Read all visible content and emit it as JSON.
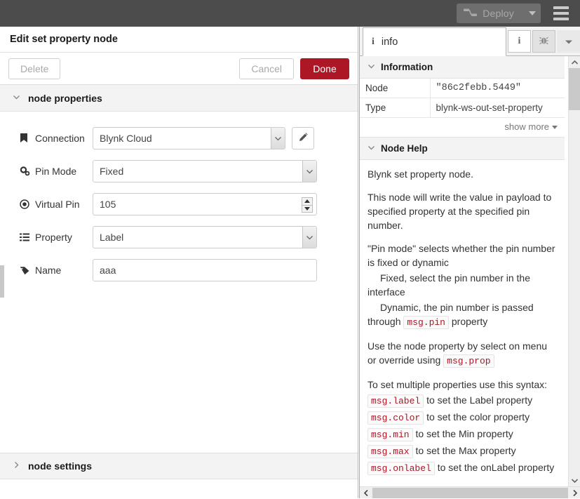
{
  "topbar": {
    "deploy_label": "Deploy",
    "deploy_icon": "deploy-node-icon",
    "deploy_caret_icon": "caret-down-icon",
    "menu_icon": "hamburger-menu-icon",
    "bg_color": "#4c4c4c",
    "deploy_disabled": true
  },
  "editor": {
    "title": "Edit set property node",
    "buttons": {
      "delete": "Delete",
      "cancel": "Cancel",
      "done": "Done",
      "done_color": "#ad1625"
    },
    "sections": {
      "properties": {
        "label": "node properties",
        "chevron": "chevron-down-icon",
        "expanded": true
      },
      "settings": {
        "label": "node settings",
        "chevron": "chevron-right-icon",
        "expanded": false
      }
    },
    "fields": [
      {
        "key": "connection",
        "icon": "bookmark-icon",
        "label": "Connection",
        "type": "select",
        "value": "Blynk Cloud",
        "has_edit_button": true,
        "edit_icon": "pencil-icon"
      },
      {
        "key": "pinmode",
        "icon": "cogs-icon",
        "label": "Pin Mode",
        "type": "select",
        "value": "Fixed"
      },
      {
        "key": "vpin",
        "icon": "dot-circle-icon",
        "label": "Virtual Pin",
        "type": "number",
        "value": "105"
      },
      {
        "key": "property",
        "icon": "list-icon",
        "label": "Property",
        "type": "select",
        "value": "Label"
      },
      {
        "key": "name",
        "icon": "tag-icon",
        "label": "Name",
        "type": "text",
        "value": "aaa"
      }
    ]
  },
  "sidebar": {
    "tab": {
      "label": "info",
      "icon": "info-icon"
    },
    "tab_buttons": [
      {
        "name": "info-tab-button",
        "icon": "info-icon",
        "active": false
      },
      {
        "name": "debug-tab-button",
        "icon": "bug-icon",
        "active": true
      },
      {
        "name": "sidebar-menu-button",
        "icon": "caret-down-icon",
        "active": false
      }
    ],
    "information": {
      "section_label": "Information",
      "chevron": "chevron-down-icon",
      "rows": [
        {
          "key": "Node",
          "value": "\"86c2febb.5449\"",
          "style": "code"
        },
        {
          "key": "Type",
          "value": "blynk-ws-out-set-property",
          "style": "plain"
        }
      ],
      "show_more": "show more"
    },
    "node_help": {
      "section_label": "Node Help",
      "chevron": "chevron-down-icon",
      "paragraphs": [
        {
          "kind": "p",
          "text": "Blynk set property node."
        },
        {
          "kind": "p",
          "text": "This node will write the value in payload to specified property at the specified pin number."
        },
        {
          "kind": "p-tight",
          "text": "\"Pin mode\" selects whether the pin number is fixed or dynamic"
        },
        {
          "kind": "p-tight-indent",
          "text": "Fixed, select the pin number in the interface"
        },
        {
          "kind": "mixed-indent",
          "pre": "Dynamic, the pin number is passed through ",
          "code": "msg.pin",
          "post": " property"
        },
        {
          "kind": "mixed",
          "pre": "Use the node property by select on menu or override using ",
          "code": "msg.prop",
          "post": ""
        },
        {
          "kind": "p-tight",
          "text": "To set multiple properties use this syntax:"
        },
        {
          "kind": "mixed-tight",
          "pre": "",
          "code": "msg.label",
          "post": " to set the Label property"
        },
        {
          "kind": "mixed-tight",
          "pre": "",
          "code": "msg.color",
          "post": " to set the color property"
        },
        {
          "kind": "mixed-tight",
          "pre": "",
          "code": "msg.min",
          "post": " to set the Min property"
        },
        {
          "kind": "mixed-tight",
          "pre": "",
          "code": "msg.max",
          "post": " to set the Max property"
        },
        {
          "kind": "mixed-tight",
          "pre": "",
          "code": "msg.onlabel",
          "post": " to set the onLabel property"
        }
      ]
    },
    "scrollbars": {
      "v_up_icon": "scroll-up-icon",
      "v_down_icon": "scroll-down-icon",
      "h_left_icon": "scroll-left-icon",
      "h_right_icon": "scroll-right-icon"
    }
  }
}
